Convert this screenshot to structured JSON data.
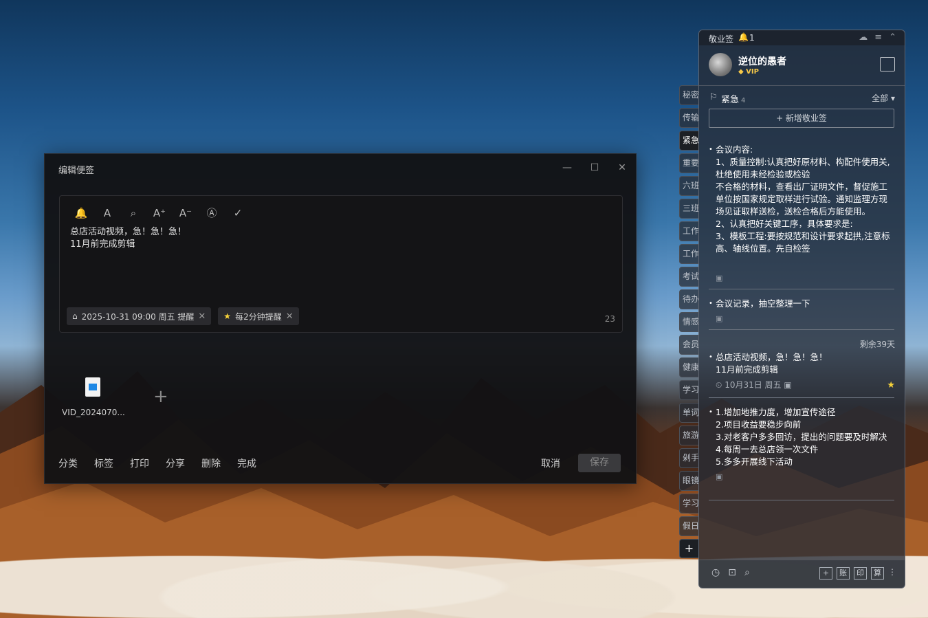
{
  "dialog": {
    "title": "编辑便签",
    "minimize": "—",
    "maximize": "☐",
    "close": "✕",
    "note_lines": [
      "总店活动视频，急！急！急！",
      "11月前完成剪辑"
    ],
    "chips": [
      {
        "icon": "bell-icon",
        "glyph": "⌂",
        "label": "2025-10-31 09:00 周五 提醒",
        "x": "✕"
      },
      {
        "icon": "star-icon",
        "glyph": "★",
        "label": "每2分钟提醒",
        "x": "✕"
      }
    ],
    "char_count": "23",
    "attachment_name": "VID_2024070...",
    "add_attachment": "+",
    "bottom_actions": [
      "分类",
      "标签",
      "打印",
      "分享",
      "删除",
      "完成"
    ],
    "cancel": "取消",
    "save": "保存"
  },
  "toolbar": [
    {
      "name": "reminder-bell-icon",
      "glyph": "🔔"
    },
    {
      "name": "text-color-icon",
      "glyph": "A"
    },
    {
      "name": "search-icon",
      "glyph": "⌕"
    },
    {
      "name": "font-increase-icon",
      "glyph": "A⁺"
    },
    {
      "name": "font-decrease-icon",
      "glyph": "A⁻"
    },
    {
      "name": "auto-format-icon",
      "glyph": "Ⓐ"
    },
    {
      "name": "check-icon",
      "glyph": "✓"
    }
  ],
  "tabs": [
    "秘密",
    "传输",
    "紧急",
    "重要",
    "六班",
    "三班",
    "工作",
    "工作",
    "考试",
    "待办",
    "情感",
    "会员",
    "健康",
    "学习",
    "单词",
    "旅游",
    "剁手",
    "眼镜",
    "学习",
    "假日"
  ],
  "active_tab": 2,
  "panel": {
    "app_name": "敬业签",
    "bell_count": "1",
    "user_name": "逆位的愚者",
    "vip": "VIP",
    "category": "紧急",
    "category_count": "4",
    "filter": "全部 ▾",
    "new_button": "+ 新增敬业签",
    "notes": [
      {
        "text": "会议内容:\n1、质量控制:认真把好原材料、构配件使用关,杜绝使用未经检验或检验\n不合格的材料，查看出厂证明文件，督促施工单位按国家规定取样进行试验。通知监理方现场见证取样送检，送检合格后方能使用。\n2、认真把好关键工序，具体要求是:\n3、模板工程:要按规范和设计要求起拱,注意标高、轴线位置。先自检签"
      },
      {
        "text": "会议记录，抽空整理一下"
      },
      {
        "text": "总店活动视频，急！急！急！\n11月前完成剪辑",
        "remaining": "剩余39天",
        "date": "10月31日 周五"
      },
      {
        "text": "1.增加地推力度，增加宣传途径\n2.项目收益要稳步向前\n3.对老客户多多回访，提出的问题要及时解决\n4.每周一去总店领一次文件\n5.多多开展线下活动"
      }
    ],
    "footer_right": [
      "+",
      "账",
      "印",
      "算"
    ]
  }
}
